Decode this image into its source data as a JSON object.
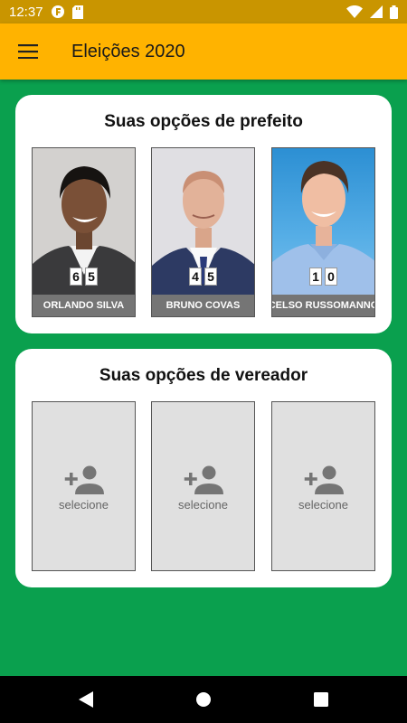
{
  "status_bar": {
    "time": "12:37",
    "icons": [
      "app-notification-icon",
      "sd-card-icon",
      "wifi-icon",
      "cell-signal-icon",
      "battery-icon"
    ]
  },
  "app_bar": {
    "title": "Eleições 2020",
    "menu_icon": "hamburger-menu-icon"
  },
  "mayor_section": {
    "title": "Suas opções de prefeito",
    "candidates": [
      {
        "name": "ORLANDO SILVA",
        "number": [
          "6",
          "5"
        ]
      },
      {
        "name": "BRUNO COVAS",
        "number": [
          "4",
          "5"
        ]
      },
      {
        "name": "CELSO RUSSOMANNO",
        "number": [
          "1",
          "0"
        ]
      }
    ]
  },
  "council_section": {
    "title": "Suas opções de vereador",
    "slots": [
      {
        "label": "selecione"
      },
      {
        "label": "selecione"
      },
      {
        "label": "selecione"
      }
    ]
  },
  "nav_bar": {
    "buttons": [
      "back-icon",
      "home-icon",
      "recents-icon"
    ]
  },
  "colors": {
    "background": "#0aa04e",
    "app_bar": "#ffb300",
    "status_bar": "#c99500",
    "name_bar": "#757575"
  }
}
